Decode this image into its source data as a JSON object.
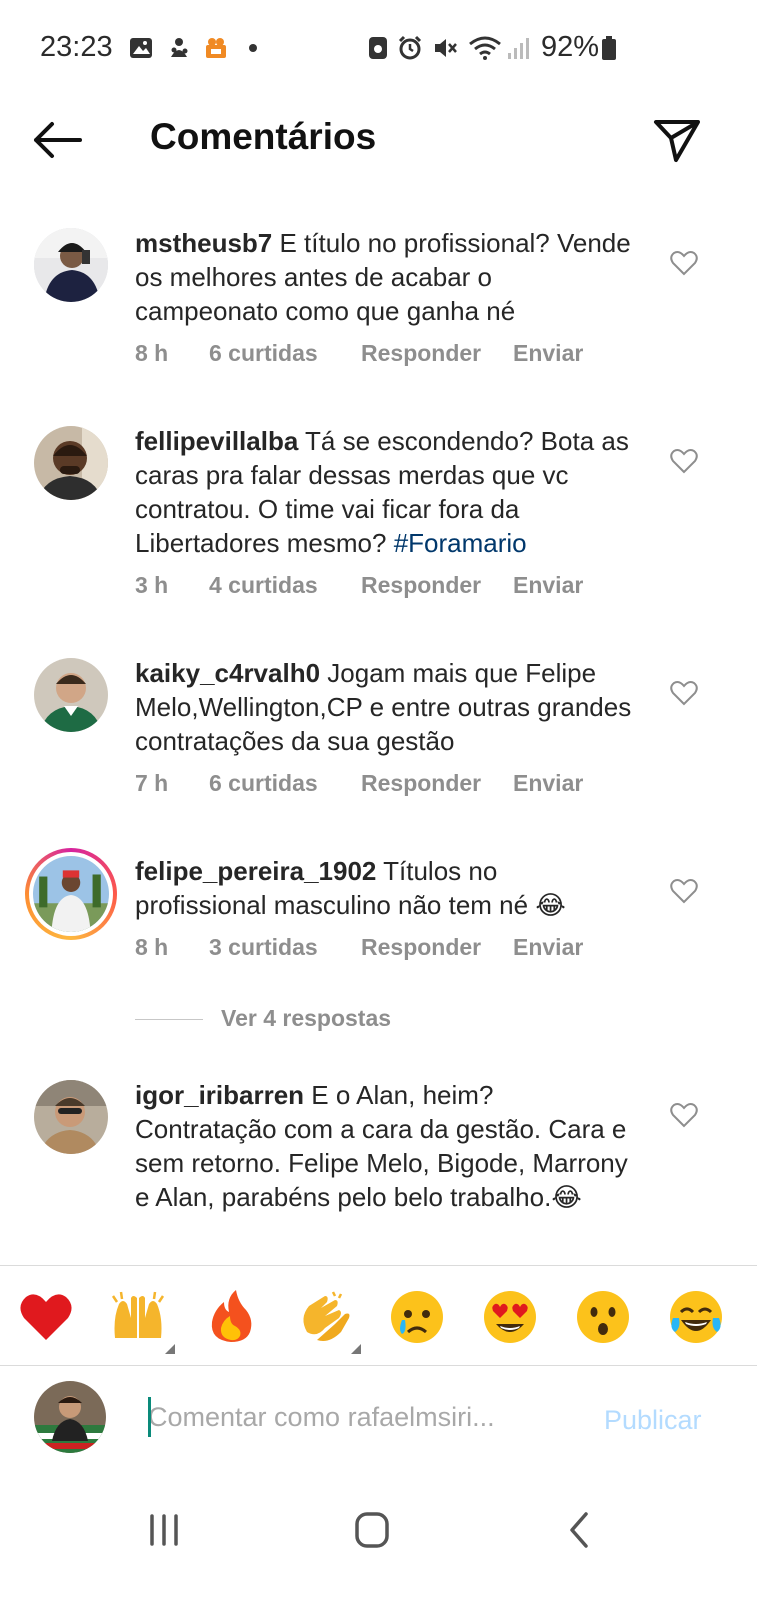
{
  "status_bar": {
    "time": "23:23",
    "battery": "92%",
    "icons": [
      "gallery-icon",
      "app-notification-icon",
      "app-notification-icon",
      "dot-icon",
      "vibrate-icon",
      "alarm-icon",
      "mute-icon",
      "wifi-icon",
      "signal-icon",
      "battery-icon"
    ]
  },
  "header": {
    "title": "Comentários",
    "back_icon": "arrow-left-icon",
    "share_icon": "paper-plane-icon"
  },
  "comments": [
    {
      "username": "mstheusb7",
      "text": " E título no profissional? Vende os melhores antes de acabar o campeonato como que ganha né",
      "time": "8 h",
      "likes": "6 curtidas",
      "reply": "Responder",
      "send": "Enviar"
    },
    {
      "username": "fellipevillalba",
      "text": " Tá se escondendo? Bota as caras pra falar dessas merdas que vc contratou. O time vai ficar fora da Libertadores mesmo? ",
      "hashtag": "#Foramario",
      "time": "3 h",
      "likes": "4 curtidas",
      "reply": "Responder",
      "send": "Enviar"
    },
    {
      "username": "kaiky_c4rvalh0",
      "text": " Jogam mais que Felipe Melo,Wellington,CP e entre outras grandes contratações da sua gestão",
      "time": "7 h",
      "likes": "6 curtidas",
      "reply": "Responder",
      "send": "Enviar"
    },
    {
      "username": "felipe_pereira_1902",
      "text": " Títulos no profissional masculino não tem né 😂",
      "time": "8 h",
      "likes": "3 curtidas",
      "reply": "Responder",
      "send": "Enviar",
      "view_replies": "Ver 4 respostas"
    },
    {
      "username": "igor_iribarren",
      "text": " E o Alan, heim? Contratação com a cara da gestão. Cara e sem retorno. Felipe Melo, Bigode, Marrony e Alan, parabéns pelo belo trabalho.😂"
    }
  ],
  "emoji_bar": [
    "❤️",
    "🙌",
    "🔥",
    "👏",
    "😢",
    "😍",
    "😮",
    "😂"
  ],
  "input": {
    "placeholder": "Comentar como rafaelmsiri...",
    "post_label": "Publicar"
  },
  "colors": {
    "hashtag": "#00376b",
    "meta": "#8e8e8e",
    "publish_disabled": "#b3dbff",
    "story_ring": "#d6249f"
  },
  "nav_bar": [
    "recent-apps-icon",
    "home-icon",
    "back-icon"
  ]
}
